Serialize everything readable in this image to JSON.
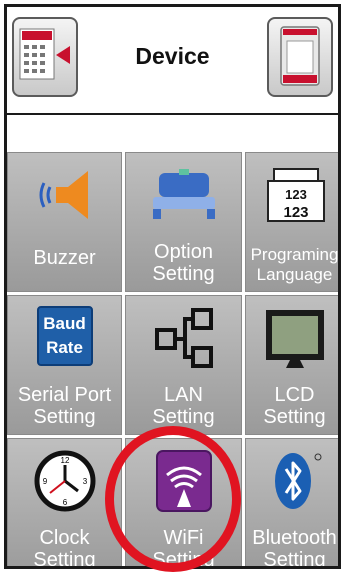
{
  "header": {
    "title": "Device"
  },
  "tiles": [
    {
      "id": "buzzer",
      "label1": "Buzzer",
      "label2": ""
    },
    {
      "id": "option",
      "label1": "Option",
      "label2": "Setting"
    },
    {
      "id": "programing",
      "label1": "Programing",
      "label2": "Language"
    },
    {
      "id": "serial",
      "label1": "Serial Port",
      "label2": "Setting",
      "badge1": "Baud",
      "badge2": "Rate"
    },
    {
      "id": "lan",
      "label1": "LAN",
      "label2": "Setting"
    },
    {
      "id": "lcd",
      "label1": "LCD",
      "label2": "Setting"
    },
    {
      "id": "clock",
      "label1": "Clock",
      "label2": "Setting"
    },
    {
      "id": "wifi",
      "label1": "WiFi",
      "label2": "Setting"
    },
    {
      "id": "bluetooth",
      "label1": "Bluetooth",
      "label2": "Setting"
    }
  ],
  "colors": {
    "highlight_circle": "#e01421",
    "tile_label": "#ffffff",
    "wifi_icon_bg": "#7a2a8f",
    "bluetooth_blue": "#1b5fb3",
    "baud_blue": "#1f5fa8"
  },
  "icons": {
    "back": "keypad-back-icon",
    "printer": "printer-icon"
  }
}
